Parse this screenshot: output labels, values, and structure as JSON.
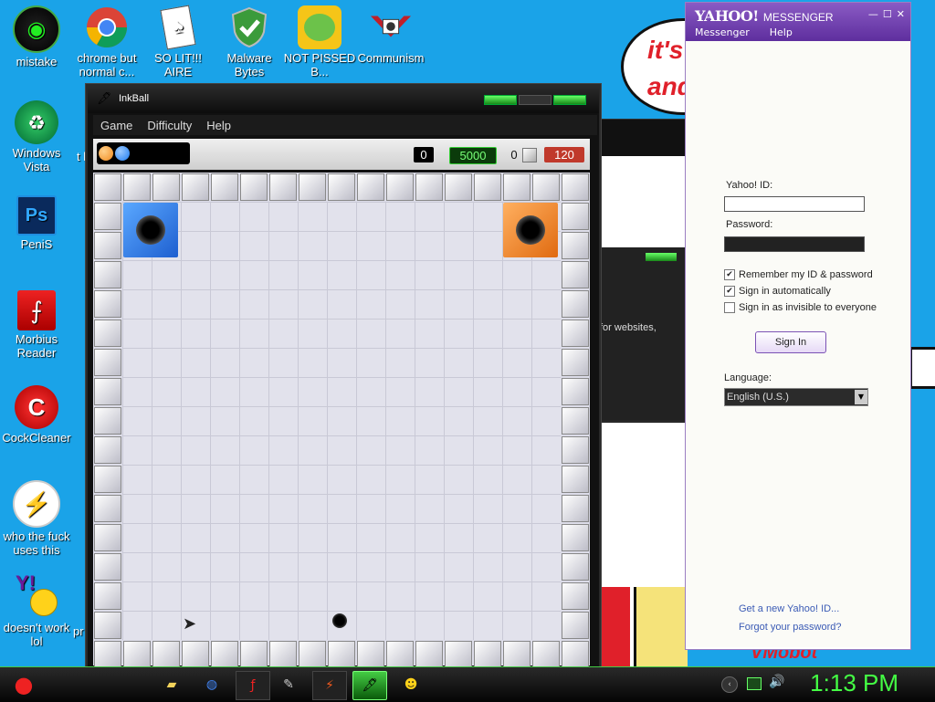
{
  "desktop": {
    "icons": [
      {
        "label": "mistake"
      },
      {
        "label": "chrome but normal c..."
      },
      {
        "label": "SO LIT!!! AIRE"
      },
      {
        "label": "Malware Bytes"
      },
      {
        "label": "NOT PISSED B..."
      },
      {
        "label": "Communism"
      },
      {
        "label": "Windows Vista"
      },
      {
        "label": "PeniS"
      },
      {
        "label": "Morbius Reader"
      },
      {
        "label": "CockCleaner"
      },
      {
        "label": "who the fuck uses this"
      },
      {
        "label": "doesn't work lol"
      }
    ],
    "cartoon_text": [
      "it's",
      "and"
    ],
    "cartoon_bottom_text": "VMobot",
    "partial_labels": [
      "t lik",
      "pr"
    ]
  },
  "background_window": {
    "text": "for websites,"
  },
  "inkball": {
    "title": "InkBall",
    "menu": [
      "Game",
      "Difficulty",
      "Help"
    ],
    "score": "0",
    "target": "5000",
    "balls_count": "0",
    "timer": "120",
    "colors": {
      "blue": "#1e7bf0",
      "orange": "#f08a1e",
      "timer_bg": "#c0392b",
      "target_bg": "#0b3b0b"
    }
  },
  "yahoo": {
    "logo": "YAHOO!",
    "logo_sub": "MESSENGER",
    "menu": [
      "Messenger",
      "Help"
    ],
    "id_label": "Yahoo! ID:",
    "password_label": "Password:",
    "checkboxes": [
      {
        "label": "Remember my ID & password",
        "checked": true
      },
      {
        "label": "Sign in automatically",
        "checked": true
      },
      {
        "label": "Sign in as invisible to everyone",
        "checked": false
      }
    ],
    "sign_in": "Sign In",
    "language_label": "Language:",
    "language_value": "English (U.S.)",
    "get_id_link": "Get a new Yahoo! ID...",
    "forgot_link": "Forgot your password?",
    "accent": "#6a37a8"
  },
  "taskbar": {
    "clock": "1:13 PM"
  }
}
